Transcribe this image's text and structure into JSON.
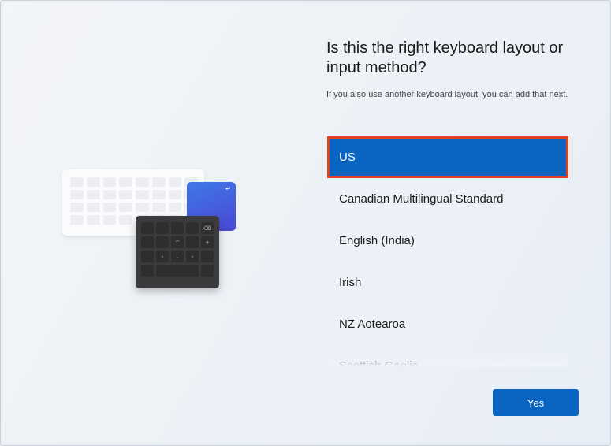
{
  "page": {
    "title": "Is this the right keyboard layout or input method?",
    "subtitle": "If you also use another keyboard layout, you can add that next."
  },
  "layouts": [
    {
      "label": "US",
      "selected": true
    },
    {
      "label": "Canadian Multilingual Standard",
      "selected": false
    },
    {
      "label": "English (India)",
      "selected": false
    },
    {
      "label": "Irish",
      "selected": false
    },
    {
      "label": "NZ Aotearoa",
      "selected": false
    },
    {
      "label": "Scottish Gaelic",
      "selected": false
    }
  ],
  "buttons": {
    "yes_label": "Yes"
  },
  "illustration": {
    "icon": "keyboard-illustration-icon",
    "numpad_glyphs": {
      "backspace": "⌫",
      "up": "^",
      "plus": "+",
      "left": "‹",
      "down": "⌄",
      "right": "›"
    },
    "enter_glyph": "↵"
  },
  "colors": {
    "accent": "#0a65c2",
    "selection_outline": "#e4421c"
  }
}
